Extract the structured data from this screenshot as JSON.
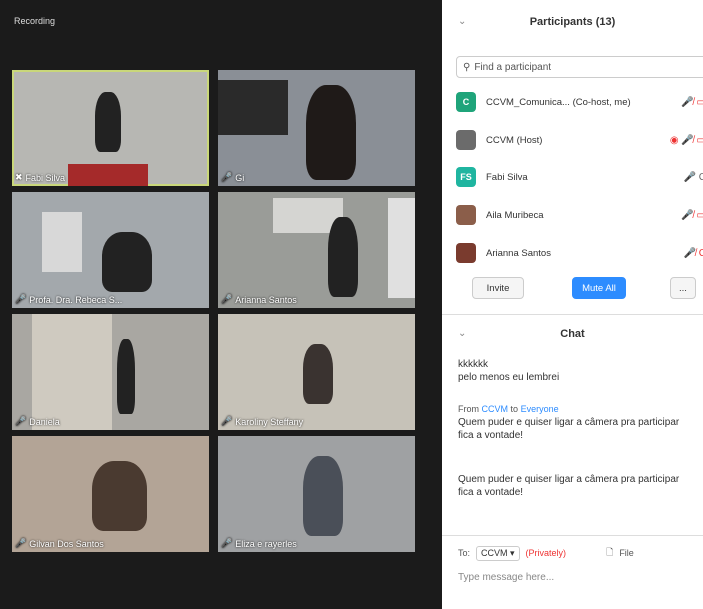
{
  "gallery": {
    "recording_label": "Recording",
    "tiles": [
      {
        "name": "Fabi Silva",
        "bg": "#b7b7b3"
      },
      {
        "name": "Gi",
        "bg": "#8a8f96"
      },
      {
        "name": "Profa. Dra. Rebeca S...",
        "bg": "#a3a8ac"
      },
      {
        "name": "Arianna Santos",
        "bg": "#9a9c98"
      },
      {
        "name": "Daniela",
        "bg": "#a9a7a2"
      },
      {
        "name": "Karoliny Steffany",
        "bg": "#c6c2b8"
      },
      {
        "name": "Gilvan Dos Santos",
        "bg": "#b3a496"
      },
      {
        "name": "Eliza e rayerles",
        "bg": "#9fa1a3"
      }
    ]
  },
  "participants": {
    "title": "Participants (13)",
    "search_placeholder": "Find a participant",
    "list": [
      {
        "initial": "C",
        "name": "CCVM_Comunica... (Co-host, me)",
        "color": "#1fa47a",
        "icons": "🎤̸ ▭"
      },
      {
        "initial": "",
        "name": "CCVM (Host)",
        "color": "#6b6b6b",
        "icons": "◉ 🎤̸ ▭"
      },
      {
        "initial": "FS",
        "name": "Fabi Silva",
        "color": "#1fb5a0",
        "icons": "🎤 C"
      },
      {
        "initial": "",
        "name": "Aila Muribeca",
        "color": "#8b5e4a",
        "icons": "🎤̸ ▭"
      },
      {
        "initial": "",
        "name": "Arianna Santos",
        "color": "#7a3b2e",
        "icons": "🎤̸ C"
      }
    ],
    "invite_label": "Invite",
    "mute_all_label": "Mute All",
    "more_label": "..."
  },
  "chat": {
    "title": "Chat",
    "line1": "kkkkkk",
    "line2": "pelo menos eu lembrei",
    "from_label": "From",
    "from_name": "CCVM",
    "to_label": "to",
    "to_name": "Everyone",
    "msg1": "Quem puder e quiser ligar a câmera pra participar fica a vontade!",
    "msg2": "Quem puder e quiser ligar a câmera pra participar fica a vontade!",
    "footer_to": "To:",
    "footer_target": "CCVM ▾",
    "footer_private": "(Privately)",
    "file_label": "File",
    "input_placeholder": "Type message here..."
  }
}
